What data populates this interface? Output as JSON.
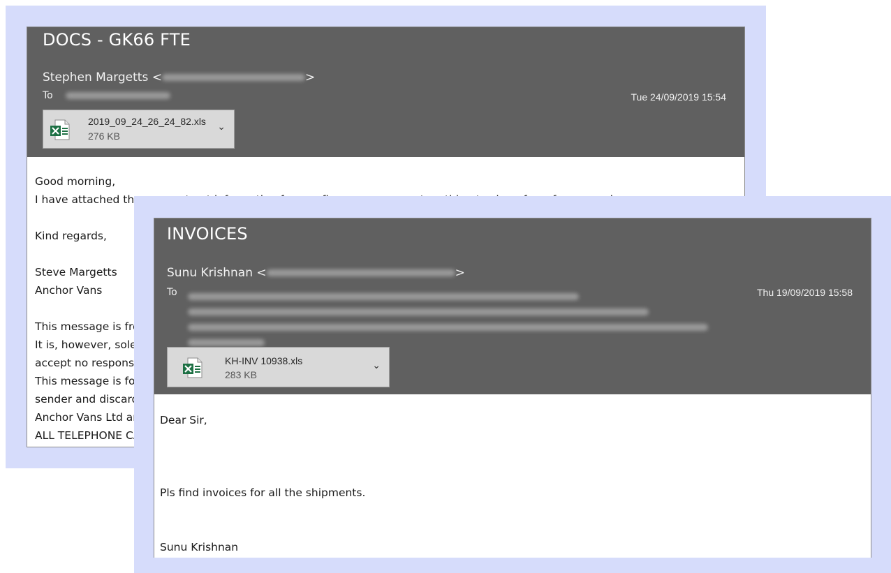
{
  "back_email": {
    "subject": "DOCS - GK66 FTE",
    "sender_name": "Stephen Margetts <",
    "sender_end": ">",
    "to_label": "To",
    "date": "Tue 24/09/2019 15:54",
    "attachment": {
      "name": "2019_09_24_26_24_82.xls",
      "size": "276 KB",
      "icon": "excel-icon"
    },
    "body": {
      "greeting": "Good morning,",
      "line1": "I have attached the pre-contract information for you finance agreement, nothing to sign , for reference only.",
      "closing": "Kind regards,",
      "sig_name": "Steve Margetts",
      "sig_company": "Anchor Vans",
      "disc1": "This message is from",
      "disc2": "It is, however, solely",
      "disc3": "accept no responsibi",
      "disc4": "This message is for th",
      "disc5": "sender and discard th",
      "disc6": "Anchor Vans Ltd are",
      "disc7": "ALL TELEPHONE CALL"
    }
  },
  "front_email": {
    "subject": "INVOICES",
    "sender_name": "Sunu Krishnan <",
    "sender_end": ">",
    "to_label": "To",
    "date": "Thu 19/09/2019 15:58",
    "attachment": {
      "name": "KH-INV 10938.xls",
      "size": "283 KB",
      "icon": "excel-icon"
    },
    "body": {
      "greeting": "Dear Sir,",
      "line1": "Pls find invoices for all the shipments.",
      "signature": "Sunu Krishnan"
    }
  },
  "colors": {
    "frame": "#d6dcfb",
    "header": "#606060",
    "excel_green": "#1d7044"
  }
}
